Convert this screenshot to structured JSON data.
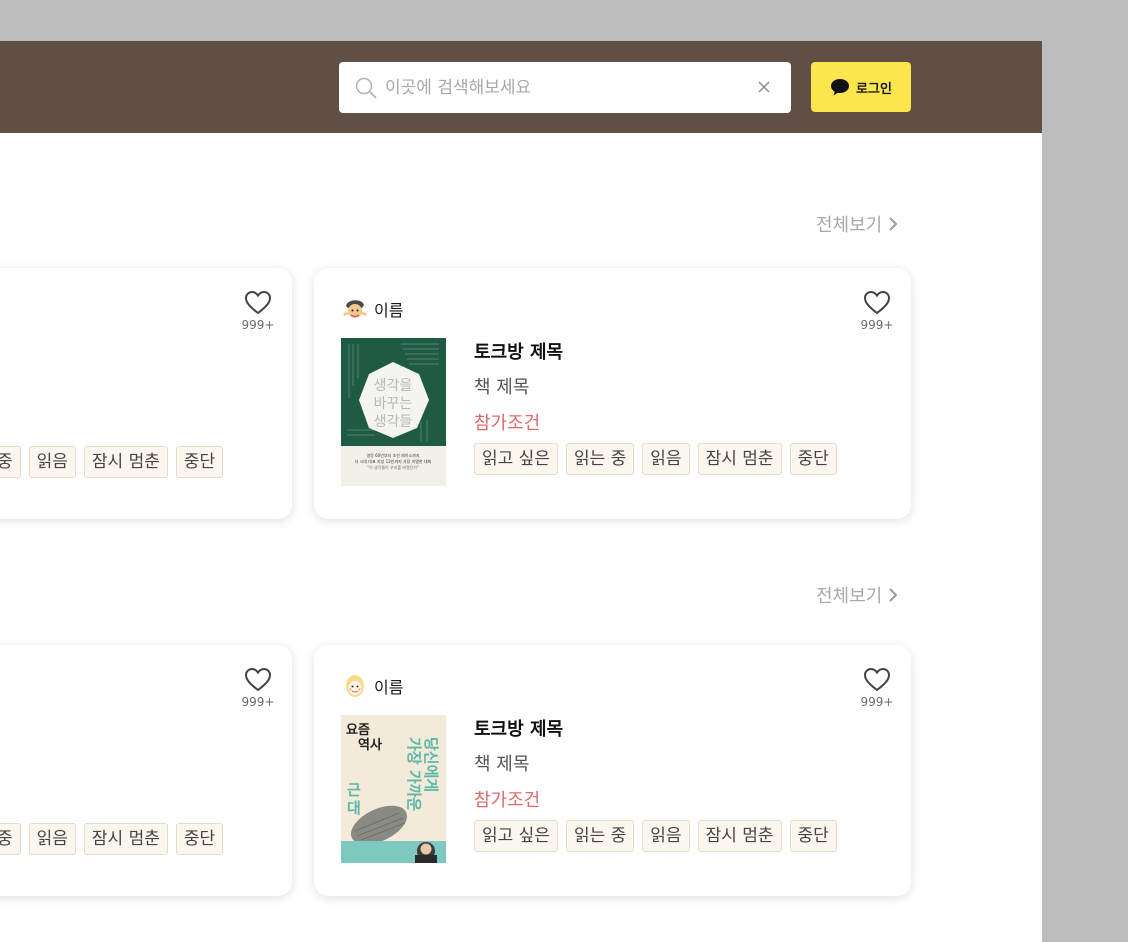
{
  "header": {
    "search": {
      "placeholder": "이곳에 검색해보세요",
      "value": ""
    },
    "login_label": "로그인",
    "colors": {
      "header_bg": "#614f45",
      "login_bg": "#fbe64d"
    }
  },
  "sections": [
    {
      "see_all": "전체보기",
      "left_card": {
        "likes": "999+",
        "tags": [
          "중",
          "읽음",
          "잠시 멈춘",
          "중단"
        ]
      },
      "right_card": {
        "user_name": "이름",
        "talk_title": "토크방 제목",
        "book_title": "책 제목",
        "condition": "참가조건",
        "likes": "999+",
        "tags": [
          "읽고 싶은",
          "읽는 중",
          "읽음",
          "잠시 멈춘",
          "중단"
        ],
        "cover": {
          "title_lines": [
            "생각을",
            "바꾸는",
            "생각들"
          ],
          "blurb": [
            "영웅 60년부터 조선 레이소까지",
            "더 시대 대표 지성 13인까지 가장 치열한 대화",
            "\"이 생각들이 우리를 바꿨던가\""
          ],
          "colors": {
            "bg": "#1f5a45",
            "bottom": "#f3f0ea"
          }
        }
      }
    },
    {
      "see_all": "전체보기",
      "left_card": {
        "likes": "999+",
        "tags": [
          "중",
          "읽음",
          "잠시 멈춘",
          "중단"
        ]
      },
      "right_card": {
        "user_name": "이름",
        "talk_title": "토크방 제목",
        "book_title": "책 제목",
        "condition": "참가조건",
        "likes": "999+",
        "tags": [
          "읽고 싶은",
          "읽는 중",
          "읽음",
          "잠시 멈춘",
          "중단"
        ],
        "cover": {
          "title_top": [
            "요즘",
            "역사"
          ],
          "title_side": [
            "근",
            "대"
          ],
          "title_right": [
            "당신에게",
            "가장 가까운"
          ],
          "colors": {
            "bg": "#f3ead9",
            "accent": "#5bb8a6"
          }
        }
      }
    }
  ]
}
